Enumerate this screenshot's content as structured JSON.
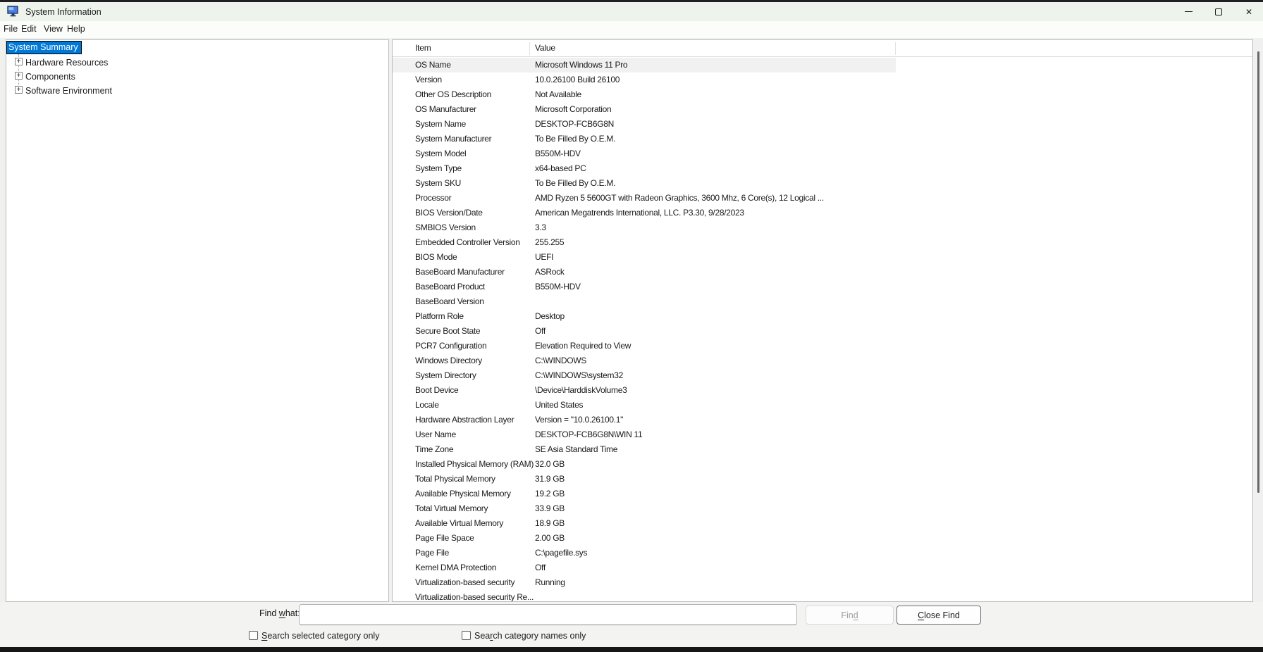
{
  "window": {
    "title": "System Information"
  },
  "menu": {
    "items": [
      "File",
      "Edit",
      "View",
      "Help"
    ]
  },
  "tree": {
    "selected": "System Summary",
    "items": [
      "Hardware Resources",
      "Components",
      "Software Environment"
    ]
  },
  "table": {
    "columns": [
      "Item",
      "Value"
    ],
    "rows": [
      {
        "item": "OS Name",
        "value": "Microsoft Windows 11 Pro",
        "highlight": true
      },
      {
        "item": "Version",
        "value": "10.0.26100 Build 26100"
      },
      {
        "item": "Other OS Description",
        "value": "Not Available"
      },
      {
        "item": "OS Manufacturer",
        "value": "Microsoft Corporation"
      },
      {
        "item": "System Name",
        "value": "DESKTOP-FCB6G8N"
      },
      {
        "item": "System Manufacturer",
        "value": "To Be Filled By O.E.M."
      },
      {
        "item": "System Model",
        "value": "B550M-HDV"
      },
      {
        "item": "System Type",
        "value": "x64-based PC"
      },
      {
        "item": "System SKU",
        "value": "To Be Filled By O.E.M."
      },
      {
        "item": "Processor",
        "value": "AMD Ryzen 5 5600GT with Radeon Graphics, 3600 Mhz, 6 Core(s), 12 Logical ..."
      },
      {
        "item": "BIOS Version/Date",
        "value": "American Megatrends International, LLC. P3.30, 9/28/2023"
      },
      {
        "item": "SMBIOS Version",
        "value": "3.3"
      },
      {
        "item": "Embedded Controller Version",
        "value": "255.255"
      },
      {
        "item": "BIOS Mode",
        "value": "UEFI"
      },
      {
        "item": "BaseBoard Manufacturer",
        "value": "ASRock"
      },
      {
        "item": "BaseBoard Product",
        "value": "B550M-HDV"
      },
      {
        "item": "BaseBoard Version",
        "value": ""
      },
      {
        "item": "Platform Role",
        "value": "Desktop"
      },
      {
        "item": "Secure Boot State",
        "value": "Off"
      },
      {
        "item": "PCR7 Configuration",
        "value": "Elevation Required to View"
      },
      {
        "item": "Windows Directory",
        "value": "C:\\WINDOWS"
      },
      {
        "item": "System Directory",
        "value": "C:\\WINDOWS\\system32"
      },
      {
        "item": "Boot Device",
        "value": "\\Device\\HarddiskVolume3"
      },
      {
        "item": "Locale",
        "value": "United States"
      },
      {
        "item": "Hardware Abstraction Layer",
        "value": "Version = \"10.0.26100.1\""
      },
      {
        "item": "User Name",
        "value": "DESKTOP-FCB6G8N\\WIN 11"
      },
      {
        "item": "Time Zone",
        "value": "SE Asia Standard Time"
      },
      {
        "item": "Installed Physical Memory (RAM)",
        "value": "32.0 GB"
      },
      {
        "item": "Total Physical Memory",
        "value": "31.9 GB"
      },
      {
        "item": "Available Physical Memory",
        "value": "19.2 GB"
      },
      {
        "item": "Total Virtual Memory",
        "value": "33.9 GB"
      },
      {
        "item": "Available Virtual Memory",
        "value": "18.9 GB"
      },
      {
        "item": "Page File Space",
        "value": "2.00 GB"
      },
      {
        "item": "Page File",
        "value": "C:\\pagefile.sys"
      },
      {
        "item": "Kernel DMA Protection",
        "value": "Off"
      },
      {
        "item": "Virtualization-based security",
        "value": "Running"
      },
      {
        "item": "Virtualization-based security Re...",
        "value": ""
      }
    ]
  },
  "find": {
    "label_pre": "Find ",
    "label_mn": "w",
    "label_post": "hat:",
    "input_value": "",
    "find_pre": "Fin",
    "find_mn": "d",
    "find_post": "",
    "close_pre": "",
    "close_mn": "C",
    "close_post": "lose Find",
    "cb1_pre": "",
    "cb1_mn": "S",
    "cb1_post": "earch selected category only",
    "cb2_pre": "Sea",
    "cb2_mn": "r",
    "cb2_post": "ch category names only"
  },
  "colors": {
    "selection_blue": "#0078d7",
    "row_highlight": "#f1f1f1",
    "titlebar_bg": "#eef4ec"
  }
}
